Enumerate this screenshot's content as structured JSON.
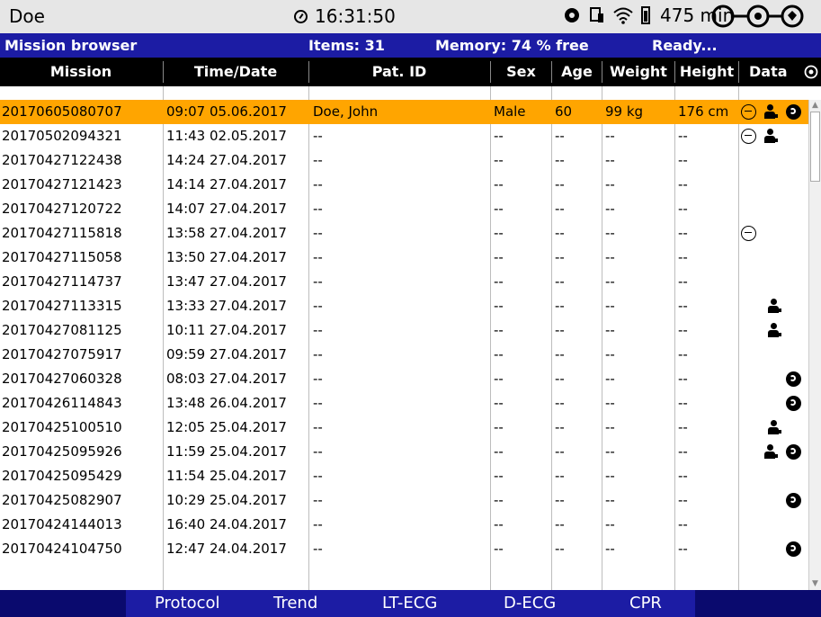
{
  "status": {
    "patient": "Doe",
    "time": "16:31:50",
    "battery_text": "475 min"
  },
  "header": {
    "title": "Mission browser",
    "items": "Items: 31",
    "memory": "Memory: 74 % free",
    "state": "Ready..."
  },
  "columns": [
    "Mission",
    "Time/Date",
    "Pat. ID",
    "Sex",
    "Age",
    "Weight",
    "Height",
    "Data"
  ],
  "rows": [
    {
      "mission": "20170605080707",
      "time": "09:07 05.06.2017",
      "patid": "Doe, John",
      "sex": "Male",
      "age": "60",
      "weight": "99 kg",
      "height": "176 cm",
      "icons": [
        "ecg-icon",
        "defib-icon",
        "cpr-icon"
      ],
      "selected": true
    },
    {
      "mission": "20170502094321",
      "time": "11:43 02.05.2017",
      "patid": "--",
      "sex": "--",
      "age": "--",
      "weight": "--",
      "height": "--",
      "icons": [
        "ecg-icon",
        "defib-icon"
      ]
    },
    {
      "mission": "20170427122438",
      "time": "14:24 27.04.2017",
      "patid": "--",
      "sex": "--",
      "age": "--",
      "weight": "--",
      "height": "--",
      "icons": []
    },
    {
      "mission": "20170427121423",
      "time": "14:14 27.04.2017",
      "patid": "--",
      "sex": "--",
      "age": "--",
      "weight": "--",
      "height": "--",
      "icons": []
    },
    {
      "mission": "20170427120722",
      "time": "14:07 27.04.2017",
      "patid": "--",
      "sex": "--",
      "age": "--",
      "weight": "--",
      "height": "--",
      "icons": []
    },
    {
      "mission": "20170427115818",
      "time": "13:58 27.04.2017",
      "patid": "--",
      "sex": "--",
      "age": "--",
      "weight": "--",
      "height": "--",
      "icons": [
        "ecg-icon"
      ]
    },
    {
      "mission": "20170427115058",
      "time": "13:50 27.04.2017",
      "patid": "--",
      "sex": "--",
      "age": "--",
      "weight": "--",
      "height": "--",
      "icons": []
    },
    {
      "mission": "20170427114737",
      "time": "13:47 27.04.2017",
      "patid": "--",
      "sex": "--",
      "age": "--",
      "weight": "--",
      "height": "--",
      "icons": []
    },
    {
      "mission": "20170427113315",
      "time": "13:33 27.04.2017",
      "patid": "--",
      "sex": "--",
      "age": "--",
      "weight": "--",
      "height": "--",
      "icons": [
        "defib-icon"
      ]
    },
    {
      "mission": "20170427081125",
      "time": "10:11 27.04.2017",
      "patid": "--",
      "sex": "--",
      "age": "--",
      "weight": "--",
      "height": "--",
      "icons": [
        "defib-icon"
      ]
    },
    {
      "mission": "20170427075917",
      "time": "09:59 27.04.2017",
      "patid": "--",
      "sex": "--",
      "age": "--",
      "weight": "--",
      "height": "--",
      "icons": []
    },
    {
      "mission": "20170427060328",
      "time": "08:03 27.04.2017",
      "patid": "--",
      "sex": "--",
      "age": "--",
      "weight": "--",
      "height": "--",
      "icons": [
        "cpr-icon"
      ]
    },
    {
      "mission": "20170426114843",
      "time": "13:48 26.04.2017",
      "patid": "--",
      "sex": "--",
      "age": "--",
      "weight": "--",
      "height": "--",
      "icons": [
        "cpr-icon"
      ]
    },
    {
      "mission": "20170425100510",
      "time": "12:05 25.04.2017",
      "patid": "--",
      "sex": "--",
      "age": "--",
      "weight": "--",
      "height": "--",
      "icons": [
        "defib-icon"
      ]
    },
    {
      "mission": "20170425095926",
      "time": "11:59 25.04.2017",
      "patid": "--",
      "sex": "--",
      "age": "--",
      "weight": "--",
      "height": "--",
      "icons": [
        "defib-icon",
        "cpr-icon"
      ]
    },
    {
      "mission": "20170425095429",
      "time": "11:54 25.04.2017",
      "patid": "--",
      "sex": "--",
      "age": "--",
      "weight": "--",
      "height": "--",
      "icons": []
    },
    {
      "mission": "20170425082907",
      "time": "10:29 25.04.2017",
      "patid": "--",
      "sex": "--",
      "age": "--",
      "weight": "--",
      "height": "--",
      "icons": [
        "cpr-icon"
      ]
    },
    {
      "mission": "20170424144013",
      "time": "16:40 24.04.2017",
      "patid": "--",
      "sex": "--",
      "age": "--",
      "weight": "--",
      "height": "--",
      "icons": []
    },
    {
      "mission": "20170424104750",
      "time": "12:47 24.04.2017",
      "patid": "--",
      "sex": "--",
      "age": "--",
      "weight": "--",
      "height": "--",
      "icons": [
        "cpr-icon"
      ]
    }
  ],
  "softkeys": [
    "Protocol",
    "Trend",
    "LT-ECG",
    "D-ECG",
    "CPR"
  ],
  "colors": {
    "header": "#1c1ca4",
    "selected": "#ffa500",
    "statusbar": "#e6e6e6"
  }
}
